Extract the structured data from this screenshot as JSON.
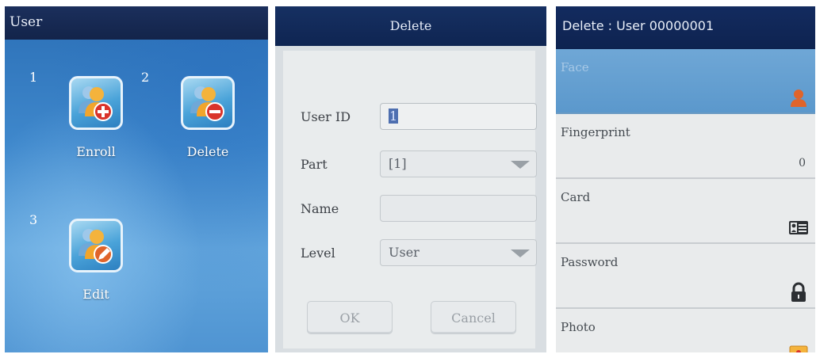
{
  "panel_menu": {
    "title": "User",
    "tiles": [
      {
        "number": "1",
        "label": "Enroll",
        "icon": "user-add-icon"
      },
      {
        "number": "2",
        "label": "Delete",
        "icon": "user-remove-icon"
      },
      {
        "number": "3",
        "label": "Edit",
        "icon": "user-edit-icon"
      }
    ]
  },
  "panel_delete": {
    "title": "Delete",
    "user_id_label": "User ID",
    "user_id_value": "1",
    "part_label": "Part",
    "part_value": "[1]",
    "name_label": "Name",
    "name_value": "",
    "level_label": "Level",
    "level_value": "User",
    "ok_label": "OK",
    "cancel_label": "Cancel"
  },
  "panel_user": {
    "title": "Delete : User 00000001",
    "items": [
      {
        "name": "Face",
        "value": "",
        "icon": "face-icon",
        "selected": true
      },
      {
        "name": "Fingerprint",
        "value": "0",
        "icon": "",
        "selected": false
      },
      {
        "name": "Card",
        "value": "",
        "icon": "id-card-icon",
        "selected": false
      },
      {
        "name": "Password",
        "value": "",
        "icon": "lock-icon",
        "selected": false
      },
      {
        "name": "Photo",
        "value": "",
        "icon": "photo-icon",
        "selected": false
      }
    ]
  },
  "colors": {
    "title_bar": "#13244a",
    "selected_row": "#5b98cc",
    "accent_orange": "#e0642a"
  }
}
